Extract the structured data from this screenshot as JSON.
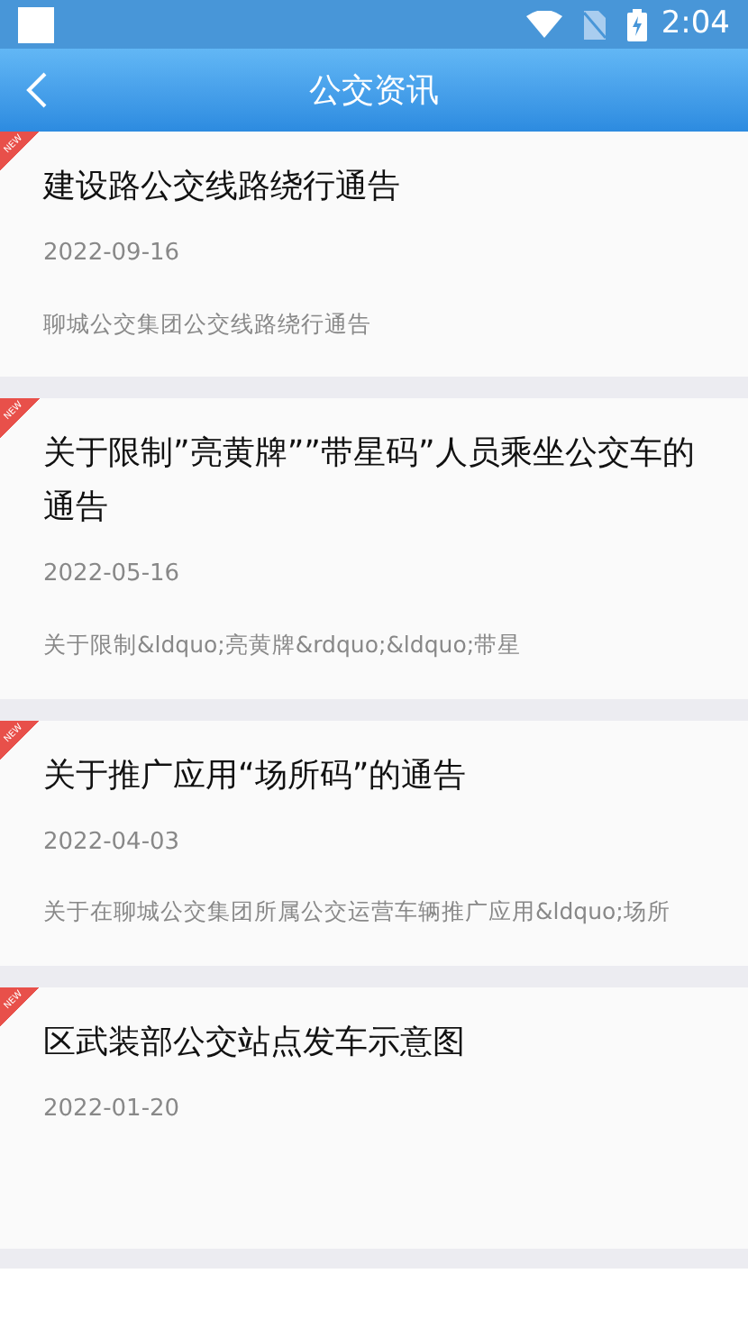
{
  "status_bar": {
    "time": "2:04"
  },
  "header": {
    "title": "公交资讯"
  },
  "news": [
    {
      "title": "建设路公交线路绕行通告",
      "date": "2022-09-16",
      "summary": "聊城公交集团公交线路绕行通告",
      "new": true,
      "ribbon": "NEW"
    },
    {
      "title": "关于限制”亮黄牌””带星码”人员乘坐公交车的通告",
      "date": "2022-05-16",
      "summary": "关于限制&ldquo;亮黄牌&rdquo;&ldquo;带星",
      "new": true,
      "ribbon": "NEW"
    },
    {
      "title": "关于推广应用“场所码”的通告",
      "date": "2022-04-03",
      "summary": "关于在聊城公交集团所属公交运营车辆推广应用&ldquo;场所",
      "new": true,
      "ribbon": "NEW"
    },
    {
      "title": "区武装部公交站点发车示意图",
      "date": "2022-01-20",
      "new": true,
      "ribbon": "NEW"
    }
  ]
}
